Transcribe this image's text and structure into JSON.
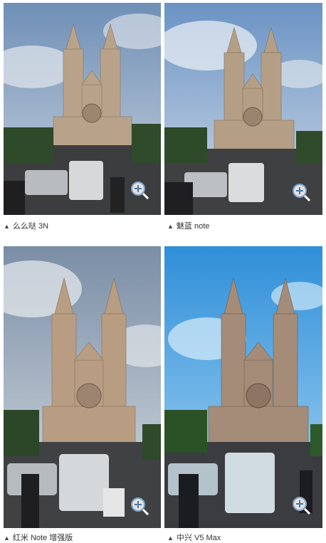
{
  "images": [
    {
      "caption": "么么哒 3N",
      "sky_top": "#6f8fb6",
      "sky_bottom": "#c9d3de",
      "tone": "#b8a38a"
    },
    {
      "caption": "魅蓝 note",
      "sky_top": "#6a93c4",
      "sky_bottom": "#cfd9e6",
      "tone": "#b49f86"
    },
    {
      "caption": "红米 Note 增强版",
      "sky_top": "#7a8ea6",
      "sky_bottom": "#d8dde3",
      "tone": "#b89d82"
    },
    {
      "caption": "中兴 V5 Max",
      "sky_top": "#2f8fd8",
      "sky_bottom": "#a9d6f5",
      "tone": "#a48c78"
    }
  ],
  "icons": {
    "zoom": "zoom-in-icon",
    "caption_marker": "triangle-up-icon"
  },
  "marker_glyph": "▲"
}
